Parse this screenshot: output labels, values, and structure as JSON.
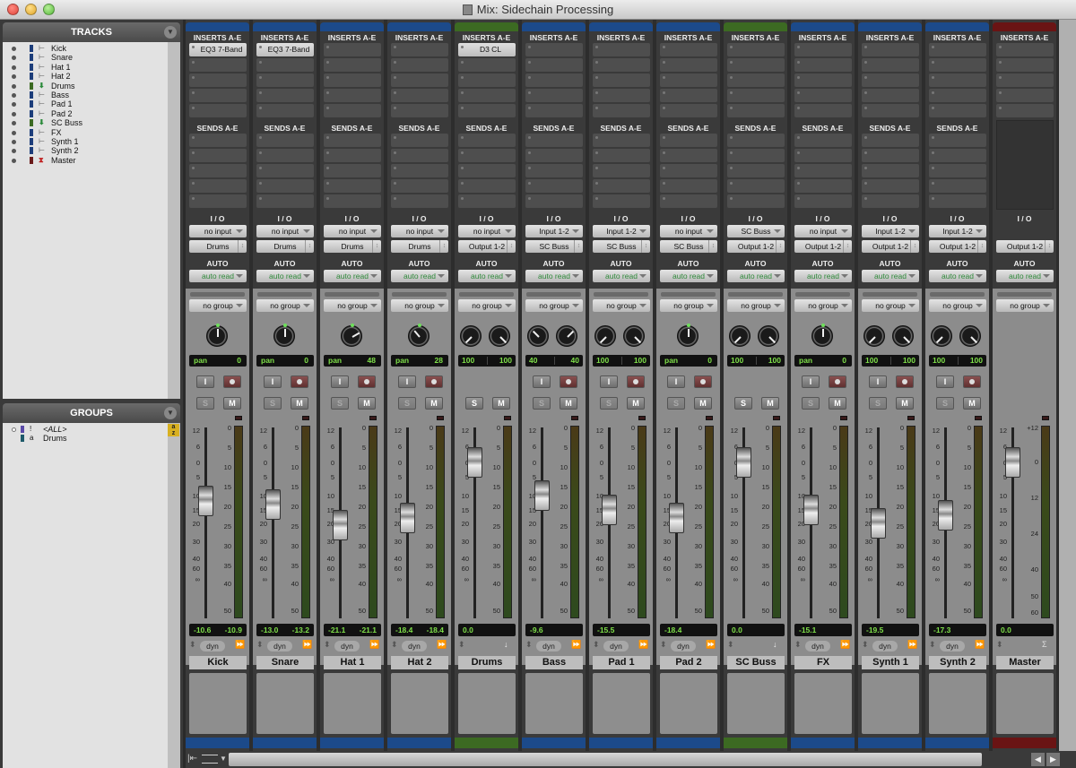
{
  "window": {
    "title": "Mix: Sidechain Processing"
  },
  "tracks_panel": {
    "header": "TRACKS",
    "items": [
      {
        "name": "Kick",
        "color": "#1c3d7a",
        "type": "audio"
      },
      {
        "name": "Snare",
        "color": "#1c3d7a",
        "type": "audio"
      },
      {
        "name": "Hat 1",
        "color": "#1c3d7a",
        "type": "audio"
      },
      {
        "name": "Hat 2",
        "color": "#1c3d7a",
        "type": "audio"
      },
      {
        "name": "Drums",
        "color": "#3c6a22",
        "type": "aux"
      },
      {
        "name": "Bass",
        "color": "#1c3d7a",
        "type": "audio"
      },
      {
        "name": "Pad 1",
        "color": "#1c3d7a",
        "type": "audio"
      },
      {
        "name": "Pad 2",
        "color": "#1c3d7a",
        "type": "audio"
      },
      {
        "name": "SC Buss",
        "color": "#3c6a22",
        "type": "aux"
      },
      {
        "name": "FX",
        "color": "#1c3d7a",
        "type": "audio"
      },
      {
        "name": "Synth 1",
        "color": "#1c3d7a",
        "type": "audio"
      },
      {
        "name": "Synth 2",
        "color": "#1c3d7a",
        "type": "audio"
      },
      {
        "name": "Master",
        "color": "#6a1a1a",
        "type": "master"
      }
    ]
  },
  "groups_panel": {
    "header": "GROUPS",
    "items": [
      {
        "id": "!",
        "name": "<ALL>",
        "color": "#5a4aa8"
      },
      {
        "id": "a",
        "name": "Drums",
        "color": "#1e5a6a"
      }
    ]
  },
  "labels": {
    "inserts": "INSERTS A-E",
    "sends": "SENDS A-E",
    "io": "I / O",
    "auto": "AUTO",
    "input_btn": "I",
    "solo_btn": "S",
    "mute_btn": "M",
    "dyn": "dyn"
  },
  "fader_scale": [
    "12",
    "6",
    "0",
    "5",
    "10",
    "15",
    "20",
    "30",
    "40",
    "60",
    "∞"
  ],
  "meter_scale": [
    "0",
    "5",
    "10",
    "15",
    "20",
    "25",
    "30",
    "35",
    "40",
    "50",
    "60"
  ],
  "master_meter_scale": [
    "+12",
    "0",
    "12",
    "24",
    "40",
    "50",
    "60"
  ],
  "strips": [
    {
      "name": "Kick",
      "color": "#1c4a8a",
      "insert": "EQ3 7-Band",
      "input": "no input",
      "output": "Drums",
      "auto": "auto read",
      "group": "no group",
      "stereo": false,
      "pan": "0",
      "pan_l": "",
      "pan_r": "",
      "vol": "-10.6",
      "peak": "-10.9",
      "fader_db": -12,
      "has_rec": true,
      "dyn": true,
      "tail": "ffwd"
    },
    {
      "name": "Snare",
      "color": "#1c4a8a",
      "insert": "EQ3 7-Band",
      "input": "no input",
      "output": "Drums",
      "auto": "auto read",
      "group": "no group",
      "stereo": false,
      "pan": "0",
      "vol": "-13.0",
      "peak": "-13.2",
      "fader_db": -13,
      "has_rec": true,
      "dyn": true,
      "tail": "ffwd"
    },
    {
      "name": "Hat 1",
      "color": "#1c4a8a",
      "insert": "",
      "input": "no input",
      "output": "Drums",
      "auto": "auto read",
      "group": "no group",
      "stereo": false,
      "pan": "48",
      "vol": "-21.1",
      "peak": "-21.1",
      "fader_db": -21,
      "has_rec": true,
      "dyn": true,
      "tail": "ffwd"
    },
    {
      "name": "Hat 2",
      "color": "#1c4a8a",
      "insert": "",
      "input": "no input",
      "output": "Drums",
      "auto": "auto read",
      "group": "no group",
      "stereo": false,
      "pan": "28",
      "vol": "-18.4",
      "peak": "-18.4",
      "fader_db": -18,
      "has_rec": true,
      "dyn": true,
      "tail": "ffwd"
    },
    {
      "name": "Drums",
      "color": "#3c6a22",
      "insert": "D3 CL",
      "input": "no input",
      "output": "Output 1-2",
      "auto": "auto read",
      "group": "no group",
      "stereo": true,
      "pan_l": "100",
      "pan_r": "100",
      "vol": "0.0",
      "peak": "",
      "fader_db": 0,
      "has_rec": false,
      "dyn": false,
      "tail": "down"
    },
    {
      "name": "Bass",
      "color": "#1c4a8a",
      "insert": "",
      "input": "Input 1-2",
      "output": "SC Buss",
      "auto": "auto read",
      "group": "no group",
      "stereo": true,
      "pan_l": "40",
      "pan_r": "40",
      "vol": "-9.6",
      "peak": "",
      "fader_db": -10,
      "has_rec": true,
      "dyn": true,
      "tail": "ffwd"
    },
    {
      "name": "Pad 1",
      "color": "#1c4a8a",
      "insert": "",
      "input": "Input 1-2",
      "output": "SC Buss",
      "auto": "auto read",
      "group": "no group",
      "stereo": true,
      "pan_l": "100",
      "pan_r": "100",
      "vol": "-15.5",
      "peak": "",
      "fader_db": -15,
      "has_rec": true,
      "dyn": true,
      "tail": "ffwd"
    },
    {
      "name": "Pad 2",
      "color": "#1c4a8a",
      "insert": "",
      "input": "no input",
      "output": "SC Buss",
      "auto": "auto read",
      "group": "no group",
      "stereo": false,
      "pan": "0",
      "vol": "-18.4",
      "peak": "",
      "fader_db": -18,
      "has_rec": true,
      "dyn": true,
      "tail": "ffwd"
    },
    {
      "name": "SC Buss",
      "color": "#3c6a22",
      "insert": "",
      "input": "SC Buss",
      "output": "Output 1-2",
      "auto": "auto read",
      "group": "no group",
      "stereo": true,
      "pan_l": "100",
      "pan_r": "100",
      "vol": "0.0",
      "peak": "",
      "fader_db": 0,
      "has_rec": false,
      "dyn": false,
      "tail": "down"
    },
    {
      "name": "FX",
      "color": "#1c4a8a",
      "insert": "",
      "input": "no input",
      "output": "Output 1-2",
      "auto": "auto read",
      "group": "no group",
      "stereo": false,
      "pan": "0",
      "vol": "-15.1",
      "peak": "",
      "fader_db": -15,
      "has_rec": true,
      "dyn": true,
      "tail": "ffwd"
    },
    {
      "name": "Synth 1",
      "color": "#1c4a8a",
      "insert": "",
      "input": "Input 1-2",
      "output": "Output 1-2",
      "auto": "auto read",
      "group": "no group",
      "stereo": true,
      "pan_l": "100",
      "pan_r": "100",
      "vol": "-19.5",
      "peak": "",
      "fader_db": -20,
      "has_rec": true,
      "dyn": true,
      "tail": "ffwd"
    },
    {
      "name": "Synth 2",
      "color": "#1c4a8a",
      "insert": "",
      "input": "Input 1-2",
      "output": "Output 1-2",
      "auto": "auto read",
      "group": "no group",
      "stereo": true,
      "pan_l": "100",
      "pan_r": "100",
      "vol": "-17.3",
      "peak": "",
      "fader_db": -17,
      "has_rec": true,
      "dyn": true,
      "tail": "ffwd"
    },
    {
      "name": "Master",
      "color": "#6a1414",
      "insert": "",
      "input": "",
      "output": "Output 1-2",
      "auto": "auto read",
      "group": "no group",
      "stereo": null,
      "vol": "0.0",
      "peak": "",
      "fader_db": 0,
      "has_rec": false,
      "dyn": false,
      "tail": "sigma",
      "master": true
    }
  ]
}
